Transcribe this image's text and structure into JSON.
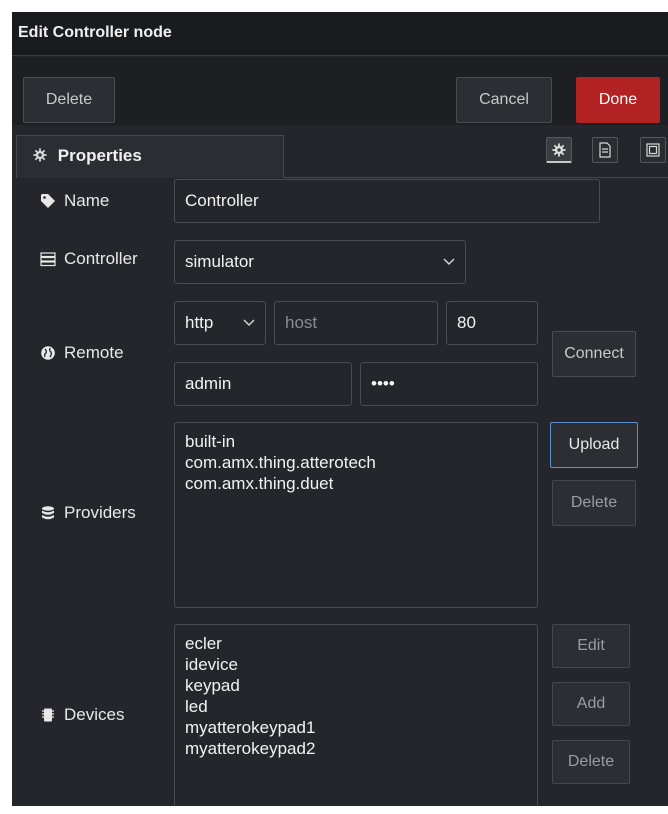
{
  "window": {
    "title": "Edit Controller node"
  },
  "toolbar": {
    "delete_label": "Delete",
    "cancel_label": "Cancel",
    "done_label": "Done"
  },
  "tabs": {
    "properties_label": "Properties"
  },
  "form": {
    "name": {
      "label": "Name",
      "value": "Controller"
    },
    "controller": {
      "label": "Controller",
      "selected": "simulator"
    },
    "remote": {
      "label": "Remote",
      "protocol": "http",
      "host_placeholder": "host",
      "port": "80",
      "username": "admin",
      "password": "••••",
      "connect_label": "Connect"
    },
    "providers": {
      "label": "Providers",
      "items": [
        "built-in",
        "com.amx.thing.atterotech",
        "com.amx.thing.duet"
      ],
      "upload_label": "Upload",
      "delete_label": "Delete"
    },
    "devices": {
      "label": "Devices",
      "items": [
        "ecler",
        "idevice",
        "keypad",
        "led",
        "myatterokeypad1",
        "myatterokeypad2"
      ],
      "edit_label": "Edit",
      "add_label": "Add",
      "delete_label": "Delete"
    }
  },
  "icons": {
    "tab": "gear-icon",
    "tab_buttons": [
      "gear-icon",
      "document-icon",
      "frame-icon"
    ],
    "name": "tag-icon",
    "controller": "server-icon",
    "remote": "globe-icon",
    "providers": "database-icon",
    "devices": "device-icon"
  },
  "colors": {
    "done": "#b22222",
    "upload_border": "#5a8fd0",
    "panel_bg": "#24262b"
  }
}
